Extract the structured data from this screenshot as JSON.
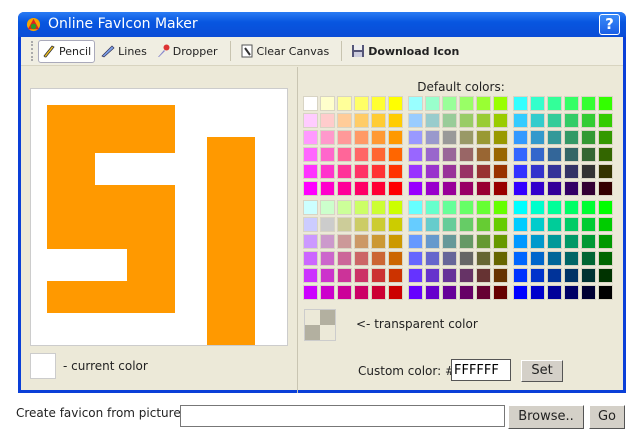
{
  "window": {
    "title": "Online FavIcon Maker",
    "help": "?"
  },
  "toolbar": {
    "pencil": "Pencil",
    "lines": "Lines",
    "dropper": "Dropper",
    "clear": "Clear Canvas",
    "download": "Download Icon"
  },
  "canvas": {
    "draw_color": "#FF9900",
    "pixels": [
      "0000000000000000",
      "0111111110000000",
      "0111111110000000",
      "0111111110011100",
      "0111000000011100",
      "0111000000011100",
      "0111111110011100",
      "0111111110011100",
      "0111111110011100",
      "0111111110011100",
      "0000001110011100",
      "0000001110011100",
      "0111111110011100",
      "0111111110011100",
      "0000000000011100",
      "0000000000011100"
    ]
  },
  "current_color": {
    "label": "- current color",
    "value": "#FFFFFF"
  },
  "palette": {
    "title": "Default colors:",
    "levels": [
      "FF",
      "CC",
      "99",
      "66",
      "33",
      "00"
    ],
    "block_red_order": [
      [
        "FF",
        "99",
        "33"
      ],
      [
        "CC",
        "66",
        "00"
      ]
    ]
  },
  "transparent": {
    "label": "<- transparent color"
  },
  "custom": {
    "label": "Custom color: #",
    "value": "FFFFFF",
    "set": "Set"
  },
  "from_picture": {
    "label": "Create favicon from picture:",
    "value": "",
    "browse": "Browse..",
    "go": "Go"
  }
}
